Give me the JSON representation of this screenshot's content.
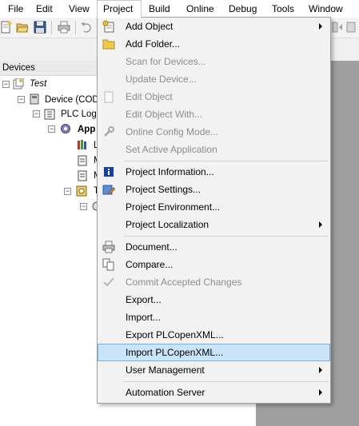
{
  "menubar": {
    "items": [
      "File",
      "Edit",
      "View",
      "Project",
      "Build",
      "Online",
      "Debug",
      "Tools",
      "Window"
    ],
    "open_item": "Project"
  },
  "devices_panel": {
    "title": "Devices"
  },
  "tree": {
    "nodes": [
      "Test",
      "Device (CODE",
      "PLC Logic",
      "App",
      "L",
      "M",
      "M",
      "T"
    ]
  },
  "dropdown": {
    "items": [
      {
        "label": "Add Object",
        "enabled": true,
        "submenu": true,
        "icon": "add-object-icon"
      },
      {
        "label": "Add Folder...",
        "enabled": true,
        "submenu": false,
        "icon": "folder-icon"
      },
      {
        "label": "Scan for Devices...",
        "enabled": false,
        "submenu": false,
        "icon": ""
      },
      {
        "label": "Update Device...",
        "enabled": false,
        "submenu": false,
        "icon": ""
      },
      {
        "label": "Edit Object",
        "enabled": false,
        "submenu": false,
        "icon": "edit-object-icon"
      },
      {
        "label": "Edit Object With...",
        "enabled": false,
        "submenu": false,
        "icon": ""
      },
      {
        "label": "Online Config Mode...",
        "enabled": false,
        "submenu": false,
        "icon": "wrench-icon"
      },
      {
        "label": "Set Active Application",
        "enabled": false,
        "submenu": false,
        "icon": ""
      },
      {
        "label": "Project Information...",
        "enabled": true,
        "submenu": false,
        "icon": "info-icon"
      },
      {
        "label": "Project Settings...",
        "enabled": true,
        "submenu": false,
        "icon": "settings-icon"
      },
      {
        "label": "Project Environment...",
        "enabled": true,
        "submenu": false,
        "icon": ""
      },
      {
        "label": "Project Localization",
        "enabled": true,
        "submenu": true,
        "icon": ""
      },
      {
        "label": "Document...",
        "enabled": true,
        "submenu": false,
        "icon": "printer-icon"
      },
      {
        "label": "Compare...",
        "enabled": true,
        "submenu": false,
        "icon": "compare-icon"
      },
      {
        "label": "Commit Accepted Changes",
        "enabled": false,
        "submenu": false,
        "icon": "commit-icon"
      },
      {
        "label": "Export...",
        "enabled": true,
        "submenu": false,
        "icon": ""
      },
      {
        "label": "Import...",
        "enabled": true,
        "submenu": false,
        "icon": ""
      },
      {
        "label": "Export PLCopenXML...",
        "enabled": true,
        "submenu": false,
        "icon": ""
      },
      {
        "label": "Import PLCopenXML...",
        "enabled": true,
        "submenu": false,
        "icon": "",
        "highlighted": true
      },
      {
        "label": "User Management",
        "enabled": true,
        "submenu": true,
        "icon": ""
      },
      {
        "label": "Automation Server",
        "enabled": true,
        "submenu": true,
        "icon": ""
      }
    ]
  },
  "colors": {
    "highlight_bg": "#cce4f7",
    "highlight_border": "#7ab0dd",
    "disabled_text": "#8d8d8d",
    "menu_bg": "#f2f2f2"
  }
}
